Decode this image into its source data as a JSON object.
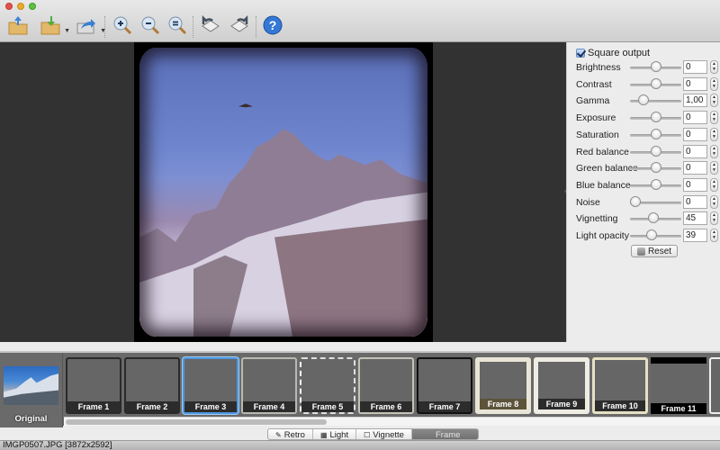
{
  "window": {
    "controls": [
      "close",
      "minimize",
      "maximize"
    ]
  },
  "toolbar": {
    "items": [
      {
        "name": "open",
        "icon": "folder-upload-icon"
      },
      {
        "name": "save",
        "icon": "folder-download-icon",
        "has_dropdown": true
      },
      {
        "name": "share",
        "icon": "share-arrow-icon",
        "has_dropdown": true
      },
      {
        "name": "zoom-in",
        "icon": "zoom-in-icon"
      },
      {
        "name": "zoom-out",
        "icon": "zoom-out-icon"
      },
      {
        "name": "zoom-fit",
        "icon": "zoom-actual-icon"
      },
      {
        "name": "rotate-left",
        "icon": "rotate-left-icon"
      },
      {
        "name": "rotate-right",
        "icon": "rotate-right-icon"
      },
      {
        "name": "help",
        "icon": "help-icon",
        "label": "?"
      }
    ]
  },
  "panel": {
    "square_output": {
      "label": "Square output",
      "checked": true
    },
    "adjustments": [
      {
        "label": "Brightness",
        "value": "0",
        "slider": 0.5
      },
      {
        "label": "Contrast",
        "value": "0",
        "slider": 0.5
      },
      {
        "label": "Gamma",
        "value": "1,00",
        "slider": 0.2
      },
      {
        "label": "Exposure",
        "value": "0",
        "slider": 0.5
      },
      {
        "label": "Saturation",
        "value": "0",
        "slider": 0.5
      },
      {
        "label": "Red balance",
        "value": "0",
        "slider": 0.5
      },
      {
        "label": "Green balance",
        "value": "0",
        "slider": 0.5
      },
      {
        "label": "Blue balance",
        "value": "0",
        "slider": 0.5
      },
      {
        "label": "Noise",
        "value": "0",
        "slider": 0.0
      },
      {
        "label": "Vignetting",
        "value": "45",
        "slider": 0.45
      },
      {
        "label": "Light opacity",
        "value": "39",
        "slider": 0.39
      }
    ],
    "reset_label": "Reset"
  },
  "filmstrip": {
    "original_label": "Original",
    "frames": [
      {
        "label": "Frame 1",
        "style": "plain"
      },
      {
        "label": "Frame 2",
        "style": "plain"
      },
      {
        "label": "Frame 3",
        "style": "sel",
        "selected": true
      },
      {
        "label": "Frame 4",
        "style": "light"
      },
      {
        "label": "Frame 5",
        "style": "dashed"
      },
      {
        "label": "Frame 6",
        "style": "worn"
      },
      {
        "label": "Frame 7",
        "style": "dark"
      },
      {
        "label": "Frame 8",
        "style": "cream"
      },
      {
        "label": "Frame 9",
        "style": "cream2"
      },
      {
        "label": "Frame 10",
        "style": "cream3"
      },
      {
        "label": "Frame 11",
        "style": "tvbar"
      },
      {
        "label": "",
        "style": "partial"
      }
    ]
  },
  "tabs": [
    {
      "label": "Retro",
      "icon": "wand-icon",
      "active": false
    },
    {
      "label": "Light",
      "icon": "light-icon",
      "active": false
    },
    {
      "label": "Vignette",
      "icon": "vignette-icon",
      "active": false
    },
    {
      "label": "Frame",
      "icon": "",
      "active": true
    }
  ],
  "status": {
    "text": "IMGP0507.JPG [3872x2592]"
  }
}
